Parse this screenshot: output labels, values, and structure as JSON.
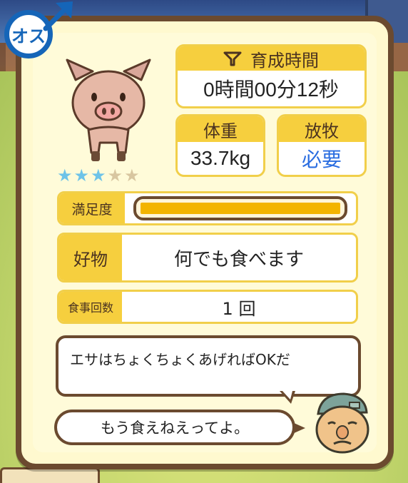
{
  "gender_badge": {
    "label": "オス"
  },
  "pig": {
    "stars": [
      true,
      true,
      true,
      false,
      false
    ]
  },
  "growth_time": {
    "label": "育成時間",
    "value": "0時間00分12秒"
  },
  "weight": {
    "label": "体重",
    "value": "33.7kg"
  },
  "grazing": {
    "label": "放牧",
    "value": "必要"
  },
  "satisfaction": {
    "label": "満足度",
    "level": 1.0
  },
  "favorite_food": {
    "label": "好物",
    "value": "何でも食べます"
  },
  "meal_count": {
    "label": "食事回数",
    "value": "1 回"
  },
  "dialogue": {
    "line1": "エサはちょくちょくあげればOKだ",
    "line2": "もう食えねえってよ。"
  },
  "colors": {
    "panel_border": "#6b4a2f",
    "header_yellow": "#f6cf3e",
    "gender_blue": "#1565b8",
    "star_on": "#6ec3e8",
    "star_off": "#d8c6a0",
    "grazing_value": "#2a6de0",
    "bar_fill": "#f3b400"
  }
}
